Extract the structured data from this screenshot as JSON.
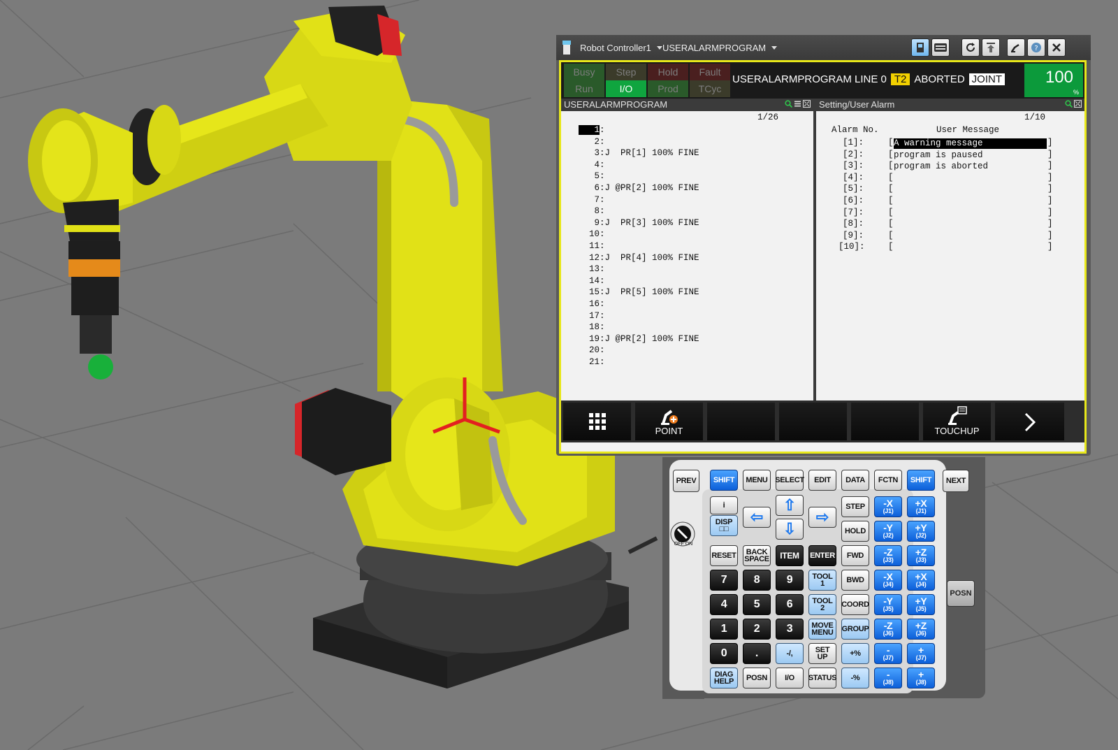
{
  "colors": {
    "screen_border": "#e8e81a",
    "robot_yellow": "#e1e117",
    "led_green_on": "#0fa53f",
    "override_green": "#0c9a3b",
    "key_blue": "#1c78ee"
  },
  "titlebar": {
    "controller": "Robot Controller1",
    "program": "USERALARMPROGRAM",
    "buttons": [
      "tp-icon",
      "keyboard-icon",
      "refresh-icon",
      "upload-icon",
      "arm-pose-icon",
      "help-icon",
      "close-icon"
    ]
  },
  "status": {
    "leds": [
      {
        "label": "Busy",
        "on": false,
        "color": "#2a5a2a"
      },
      {
        "label": "Step",
        "on": false,
        "color": "#3b3b2a"
      },
      {
        "label": "Hold",
        "on": false,
        "color": "#4a1f1f"
      },
      {
        "label": "Fault",
        "on": false,
        "color": "#4a1f1f"
      },
      {
        "label": "Run",
        "on": false,
        "color": "#2a5a2a"
      },
      {
        "label": "I/O",
        "on": true,
        "color": "#0fa53f"
      },
      {
        "label": "Prod",
        "on": false,
        "color": "#2a5a2a"
      },
      {
        "label": "TCyc",
        "on": false,
        "color": "#3b3b2a"
      }
    ],
    "program_line": "USERALARMPROGRAM LINE 0",
    "mode": "T2",
    "state": "ABORTED",
    "coord": "JOINT",
    "override": "100",
    "override_unit": "%"
  },
  "left_pane": {
    "title": "USERALARMPROGRAM",
    "counter": "1/26",
    "lines": [
      {
        "num": "1",
        "text": ":"
      },
      {
        "num": "2",
        "text": ":"
      },
      {
        "num": "3",
        "text": ":J  PR[1] 100% FINE"
      },
      {
        "num": "4",
        "text": ":"
      },
      {
        "num": "5",
        "text": ":"
      },
      {
        "num": "6",
        "text": ":J @PR[2] 100% FINE"
      },
      {
        "num": "7",
        "text": ":"
      },
      {
        "num": "8",
        "text": ":"
      },
      {
        "num": "9",
        "text": ":J  PR[3] 100% FINE"
      },
      {
        "num": "10",
        "text": ":"
      },
      {
        "num": "11",
        "text": ":"
      },
      {
        "num": "12",
        "text": ":J  PR[4] 100% FINE"
      },
      {
        "num": "13",
        "text": ":"
      },
      {
        "num": "14",
        "text": ":"
      },
      {
        "num": "15",
        "text": ":J  PR[5] 100% FINE"
      },
      {
        "num": "16",
        "text": ":"
      },
      {
        "num": "17",
        "text": ":"
      },
      {
        "num": "18",
        "text": ":"
      },
      {
        "num": "19",
        "text": ":J @PR[2] 100% FINE"
      },
      {
        "num": "20",
        "text": ":"
      },
      {
        "num": "21",
        "text": ":"
      }
    ]
  },
  "right_pane": {
    "title": "Setting/User Alarm",
    "counter": "1/10",
    "col_alarm": "Alarm No.",
    "col_msg": "User Message",
    "rows": [
      {
        "no": "[1]:",
        "msg": "A warning message"
      },
      {
        "no": "[2]:",
        "msg": "program is paused"
      },
      {
        "no": "[3]:",
        "msg": "program is aborted"
      },
      {
        "no": "[4]:",
        "msg": ""
      },
      {
        "no": "[5]:",
        "msg": ""
      },
      {
        "no": "[6]:",
        "msg": ""
      },
      {
        "no": "[7]:",
        "msg": ""
      },
      {
        "no": "[8]:",
        "msg": ""
      },
      {
        "no": "[9]:",
        "msg": ""
      },
      {
        "no": "[10]:",
        "msg": ""
      }
    ],
    "bracket_open": "[",
    "bracket_close": "]"
  },
  "fkeys": {
    "f1": "",
    "f2": "POINT",
    "f3": "",
    "f4": "",
    "f5": "",
    "f6": "TOUCHUP",
    "next": ""
  },
  "keypad": {
    "prev": "PREV",
    "shift": "SHIFT",
    "menu": "MENU",
    "select": "SELECT",
    "edit": "EDIT",
    "data": "DATA",
    "fctn": "FCTN",
    "next": "NEXT",
    "info": "i",
    "disp": "DISP",
    "step": "STEP",
    "hold": "HOLD",
    "fwd": "FWD",
    "bwd": "BWD",
    "reset": "RESET",
    "backspace_1": "BACK",
    "backspace_2": "SPACE",
    "item": "ITEM",
    "enter": "ENTER",
    "tool1_1": "TOOL",
    "tool1_2": "1",
    "tool2_1": "TOOL",
    "tool2_2": "2",
    "move_1": "MOVE",
    "move_2": "MENU",
    "setup_1": "SET",
    "setup_2": "UP",
    "status": "STATUS",
    "coord": "COORD",
    "group": "GROUP",
    "plus_pct": "+%",
    "minus_pct": "-%",
    "diag_1": "DIAG",
    "diag_2": "HELP",
    "posn": "POSN",
    "io": "I/O",
    "digits": [
      "7",
      "8",
      "9",
      "4",
      "5",
      "6",
      "1",
      "2",
      "3",
      "0",
      "."
    ],
    "minus_comma": "-/,",
    "side_posn": "POSN",
    "knob_off": "OFF",
    "knob_on": "ON",
    "jog": [
      {
        "a": "-X",
        "b": "(J1)"
      },
      {
        "a": "+X",
        "b": "(J1)"
      },
      {
        "a": "-Y",
        "b": "(J2)"
      },
      {
        "a": "+Y",
        "b": "(J2)"
      },
      {
        "a": "-Z",
        "b": "(J3)"
      },
      {
        "a": "+Z",
        "b": "(J3)"
      },
      {
        "a": "-X",
        "b": "(J4)"
      },
      {
        "a": "+X",
        "b": "(J4)"
      },
      {
        "a": "-Y",
        "b": "(J5)"
      },
      {
        "a": "+Y",
        "b": "(J5)"
      },
      {
        "a": "-Z",
        "b": "(J6)"
      },
      {
        "a": "+Z",
        "b": "(J6)"
      },
      {
        "a": "-",
        "b": "(J7)"
      },
      {
        "a": "+",
        "b": "(J7)"
      },
      {
        "a": "-",
        "b": "(J8)"
      },
      {
        "a": "+",
        "b": "(J8)"
      }
    ]
  }
}
